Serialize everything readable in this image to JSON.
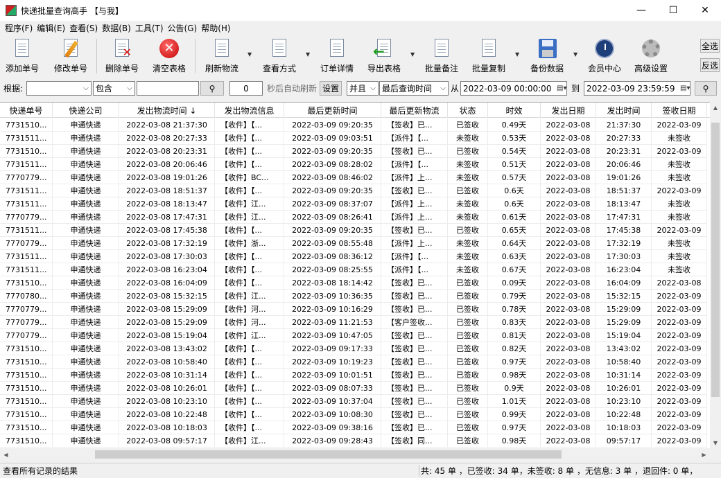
{
  "window": {
    "title": "快递批量查询高手 【与我】",
    "minimize": "—",
    "maximize": "☐",
    "close": "✕"
  },
  "menu": [
    "程序(F)",
    "编辑(E)",
    "查看(S)",
    "数据(B)",
    "工具(T)",
    "公告(G)",
    "帮助(H)"
  ],
  "toolbar": {
    "add": "添加单号",
    "edit": "修改单号",
    "delete": "删除单号",
    "clear": "清空表格",
    "refresh": "刷新物流",
    "view_mode": "查看方式",
    "order_detail": "订单详情",
    "export": "导出表格",
    "batch_note": "批量备注",
    "batch_copy": "批量复制",
    "backup": "备份数据",
    "member": "会员中心",
    "advanced": "高级设置",
    "select_all": "全选",
    "invert": "反选"
  },
  "filter": {
    "by_label": "根据:",
    "field_value": "",
    "mode_value": "包含",
    "search_text": "",
    "search_icon": "magnifier-icon",
    "refresh_seconds": "0",
    "auto_refresh_label": "秒后自动刷新",
    "settings_button": "设置",
    "logic_value": "并且",
    "time_field_value": "最后查询时间",
    "from_label": "从",
    "from_value": "2022-03-09 00:00:00",
    "to_label": "到",
    "to_value": "2022-03-09 23:59:59"
  },
  "table": {
    "columns": [
      "快递单号",
      "快递公司",
      "发出物流时间 ↓",
      "发出物流信息",
      "最后更新时间",
      "最后更新物流",
      "状态",
      "时效",
      "发出日期",
      "发出时间",
      "签收日期"
    ],
    "rows": [
      [
        "7731510...",
        "申通快递",
        "2022-03-08 21:37:30",
        "【收件】【...",
        "2022-03-09 09:20:35",
        "【签收】已...",
        "已签收",
        "0.49天",
        "2022-03-08",
        "21:37:30",
        "2022-03-09"
      ],
      [
        "7731511...",
        "申通快递",
        "2022-03-08 20:27:33",
        "【收件】【...",
        "2022-03-09 09:03:51",
        "【派件】【...",
        "未签收",
        "0.53天",
        "2022-03-08",
        "20:27:33",
        "未签收"
      ],
      [
        "7731510...",
        "申通快递",
        "2022-03-08 20:23:31",
        "【收件】【...",
        "2022-03-09 09:20:35",
        "【签收】已...",
        "已签收",
        "0.54天",
        "2022-03-08",
        "20:23:31",
        "2022-03-09"
      ],
      [
        "7731511...",
        "申通快递",
        "2022-03-08 20:06:46",
        "【收件】【...",
        "2022-03-09 08:28:02",
        "【派件】【...",
        "未签收",
        "0.51天",
        "2022-03-08",
        "20:06:46",
        "未签收"
      ],
      [
        "7770779...",
        "申通快递",
        "2022-03-08 19:01:26",
        "【收件】BC...",
        "2022-03-09 08:46:02",
        "【派件】上...",
        "未签收",
        "0.57天",
        "2022-03-08",
        "19:01:26",
        "未签收"
      ],
      [
        "7731511...",
        "申通快递",
        "2022-03-08 18:51:37",
        "【收件】【...",
        "2022-03-09 09:20:35",
        "【签收】已...",
        "已签收",
        "0.6天",
        "2022-03-08",
        "18:51:37",
        "2022-03-09"
      ],
      [
        "7731511...",
        "申通快递",
        "2022-03-08 18:13:47",
        "【收件】江...",
        "2022-03-09 08:37:07",
        "【派件】上...",
        "未签收",
        "0.6天",
        "2022-03-08",
        "18:13:47",
        "未签收"
      ],
      [
        "7770779...",
        "申通快递",
        "2022-03-08 17:47:31",
        "【收件】江...",
        "2022-03-09 08:26:41",
        "【派件】上...",
        "未签收",
        "0.61天",
        "2022-03-08",
        "17:47:31",
        "未签收"
      ],
      [
        "7731511...",
        "申通快递",
        "2022-03-08 17:45:38",
        "【收件】【...",
        "2022-03-09 09:20:35",
        "【签收】已...",
        "已签收",
        "0.65天",
        "2022-03-08",
        "17:45:38",
        "2022-03-09"
      ],
      [
        "7770779...",
        "申通快递",
        "2022-03-08 17:32:19",
        "【收件】浙...",
        "2022-03-09 08:55:48",
        "【派件】上...",
        "未签收",
        "0.64天",
        "2022-03-08",
        "17:32:19",
        "未签收"
      ],
      [
        "7731511...",
        "申通快递",
        "2022-03-08 17:30:03",
        "【收件】【...",
        "2022-03-09 08:36:12",
        "【派件】【...",
        "未签收",
        "0.63天",
        "2022-03-08",
        "17:30:03",
        "未签收"
      ],
      [
        "7731511...",
        "申通快递",
        "2022-03-08 16:23:04",
        "【收件】【...",
        "2022-03-09 08:25:55",
        "【派件】【...",
        "未签收",
        "0.67天",
        "2022-03-08",
        "16:23:04",
        "未签收"
      ],
      [
        "7731510...",
        "申通快递",
        "2022-03-08 16:04:09",
        "【收件】【...",
        "2022-03-08 18:14:42",
        "【签收】已...",
        "已签收",
        "0.09天",
        "2022-03-08",
        "16:04:09",
        "2022-03-08"
      ],
      [
        "7770780...",
        "申通快递",
        "2022-03-08 15:32:15",
        "【收件】江...",
        "2022-03-09 10:36:35",
        "【签收】已...",
        "已签收",
        "0.79天",
        "2022-03-08",
        "15:32:15",
        "2022-03-09"
      ],
      [
        "7770779...",
        "申通快递",
        "2022-03-08 15:29:09",
        "【收件】河...",
        "2022-03-09 10:16:29",
        "【签收】已...",
        "已签收",
        "0.78天",
        "2022-03-08",
        "15:29:09",
        "2022-03-09"
      ],
      [
        "7770779...",
        "申通快递",
        "2022-03-08 15:29:09",
        "【收件】河...",
        "2022-03-09 11:21:53",
        "【客户签收...",
        "已签收",
        "0.83天",
        "2022-03-08",
        "15:29:09",
        "2022-03-09"
      ],
      [
        "7770779...",
        "申通快递",
        "2022-03-08 15:19:04",
        "【收件】江...",
        "2022-03-09 10:47:05",
        "【签收】已...",
        "已签收",
        "0.81天",
        "2022-03-08",
        "15:19:04",
        "2022-03-09"
      ],
      [
        "7731510...",
        "申通快递",
        "2022-03-08 13:43:02",
        "【收件】【...",
        "2022-03-09 09:17:33",
        "【签收】已...",
        "已签收",
        "0.82天",
        "2022-03-08",
        "13:43:02",
        "2022-03-09"
      ],
      [
        "7731510...",
        "申通快递",
        "2022-03-08 10:58:40",
        "【收件】【...",
        "2022-03-09 10:19:23",
        "【签收】已...",
        "已签收",
        "0.97天",
        "2022-03-08",
        "10:58:40",
        "2022-03-09"
      ],
      [
        "7731510...",
        "申通快递",
        "2022-03-08 10:31:14",
        "【收件】【...",
        "2022-03-09 10:01:51",
        "【签收】已...",
        "已签收",
        "0.98天",
        "2022-03-08",
        "10:31:14",
        "2022-03-09"
      ],
      [
        "7731510...",
        "申通快递",
        "2022-03-08 10:26:01",
        "【收件】【...",
        "2022-03-09 08:07:33",
        "【签收】已...",
        "已签收",
        "0.9天",
        "2022-03-08",
        "10:26:01",
        "2022-03-09"
      ],
      [
        "7731510...",
        "申通快递",
        "2022-03-08 10:23:10",
        "【收件】【...",
        "2022-03-09 10:37:04",
        "【签收】已...",
        "已签收",
        "1.01天",
        "2022-03-08",
        "10:23:10",
        "2022-03-09"
      ],
      [
        "7731510...",
        "申通快递",
        "2022-03-08 10:22:48",
        "【收件】【...",
        "2022-03-09 10:08:30",
        "【签收】已...",
        "已签收",
        "0.99天",
        "2022-03-08",
        "10:22:48",
        "2022-03-09"
      ],
      [
        "7731510...",
        "申通快递",
        "2022-03-08 10:18:03",
        "【收件】【...",
        "2022-03-09 09:38:16",
        "【签收】已...",
        "已签收",
        "0.97天",
        "2022-03-08",
        "10:18:03",
        "2022-03-09"
      ],
      [
        "7731510...",
        "申通快递",
        "2022-03-08 09:57:17",
        "【收件】江...",
        "2022-03-09 09:28:43",
        "【签收】同...",
        "已签收",
        "0.98天",
        "2022-03-08",
        "09:57:17",
        "2022-03-09"
      ]
    ]
  },
  "status": {
    "left": "查看所有记录的结果",
    "right": "共: 45 单 ，已签收:  34 单，未签收:  8 单 ，无信息: 3 单 ，退回件: 0 单，"
  }
}
